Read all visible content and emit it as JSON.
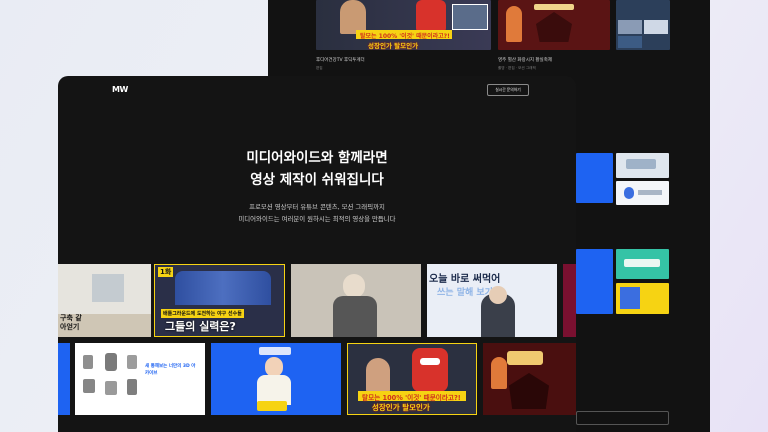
{
  "background_window": {
    "cards": [
      {
        "caption": "후디어건강TV 후딕투게더",
        "sub": "편집"
      },
      {
        "caption": "영주 별산 화랑시지 황실축제",
        "sub": "촬영 · 편집 · 모션 그래픽"
      }
    ],
    "top_thumb_text": {
      "line1": "탈모는 100% '이것' 때문이라고?!",
      "line2": "성장인가 탈모인가"
    }
  },
  "main_window": {
    "logo": "MW",
    "realtime_button": "실시간 문의하기",
    "hero": {
      "title_line1": "미디어와이드와 함께라면",
      "title_line2": "영상 제작이 쉬워집니다",
      "sub_line1": "프로모션 영상부터 유튜브 콘텐츠, 모션 그래픽까지",
      "sub_line2": "미디어와이드는 여러분이 원하시는 최적의 영상을 만듭니다"
    },
    "row1": {
      "thumb1_text": "구축 같아얻기",
      "thumb2_badge": "1화",
      "thumb2_caption": "배틀그라운드에 도전하는 야구 선수들",
      "thumb2_title": "그들의 실력은?",
      "thumb4_line1": "오늘 바로 써먹어",
      "thumb4_line2": "쓰는 말해 보기"
    },
    "row2": {
      "thumb_product_title": "새 통해보는 너만의 3D 아카이브",
      "thumb_hair_text1": "탈모는 100% '이것' 때문이라고?!",
      "thumb_hair_text2": "성장인가 탈모인가"
    }
  },
  "colors": {
    "accent_blue": "#1e63f2",
    "yellow": "#f6d313",
    "dark": "#141414"
  }
}
